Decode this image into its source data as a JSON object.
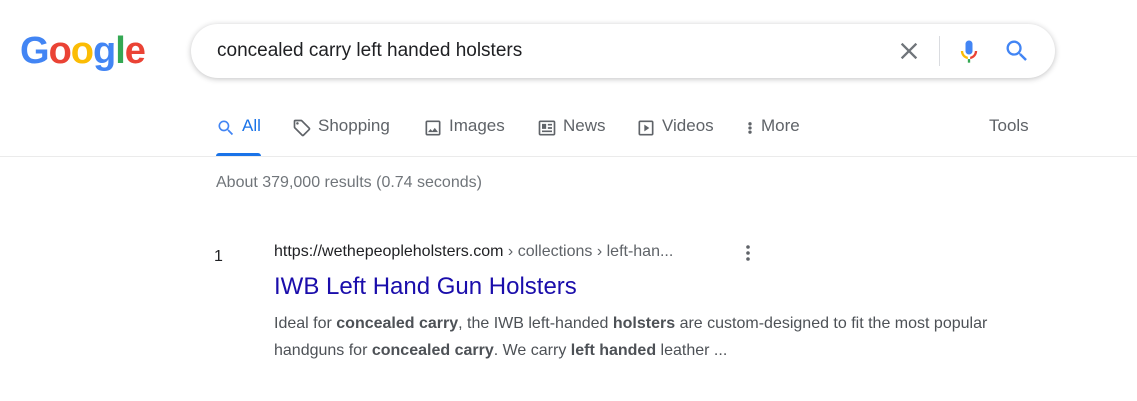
{
  "logo": {
    "letters": [
      "G",
      "o",
      "o",
      "g",
      "l",
      "e"
    ],
    "colors": [
      "#4285F4",
      "#EA4335",
      "#FBBC05",
      "#4285F4",
      "#34A853",
      "#EA4335"
    ]
  },
  "search": {
    "query": "concealed carry left handed holsters"
  },
  "tabs": [
    {
      "label": "All",
      "icon": "search-icon",
      "active": true
    },
    {
      "label": "Shopping",
      "icon": "tag-icon"
    },
    {
      "label": "Images",
      "icon": "image-icon"
    },
    {
      "label": "News",
      "icon": "newspaper-icon"
    },
    {
      "label": "Videos",
      "icon": "play-icon"
    },
    {
      "label": "More",
      "icon": "more-vert-icon"
    }
  ],
  "tools_label": "Tools",
  "result_stats": "About 379,000 results (0.74 seconds)",
  "results": [
    {
      "rank": "1",
      "site": "https://wethepeopleholsters.com",
      "path": " › collections › left-han...",
      "title": "IWB Left Hand Gun Holsters",
      "snippet": [
        {
          "text": "Ideal for ",
          "bold": false
        },
        {
          "text": "concealed carry",
          "bold": true
        },
        {
          "text": ", the IWB left-handed ",
          "bold": false
        },
        {
          "text": "holsters",
          "bold": true
        },
        {
          "text": " are custom-designed to fit the most popular handguns for ",
          "bold": false
        },
        {
          "text": "concealed carry",
          "bold": true
        },
        {
          "text": ". We carry ",
          "bold": false
        },
        {
          "text": "left handed",
          "bold": true
        },
        {
          "text": " leather ...",
          "bold": false
        }
      ]
    }
  ],
  "colors": {
    "link": "#1a0dab",
    "accent": "#1a73e8",
    "muted": "#70757a",
    "snippet": "#4d5156"
  }
}
